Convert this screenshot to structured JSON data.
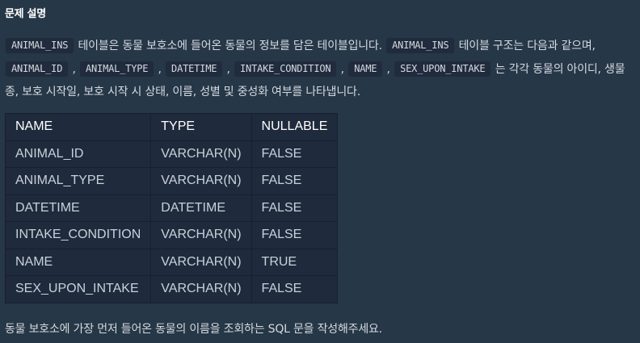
{
  "section_title": "문제 설명",
  "description": {
    "code_table": "ANIMAL_INS",
    "text_1": " 테이블은 동물 보호소에 들어온 동물의 정보를 담은 테이블입니다. ",
    "code_table_2": "ANIMAL_INS",
    "text_2": " 테이블 구조는 다음과 같으며, ",
    "code_col_1": "ANIMAL_ID",
    "sep_1": " , ",
    "code_col_2": "ANIMAL_TYPE",
    "sep_2": " , ",
    "code_col_3": "DATETIME",
    "sep_3": " , ",
    "code_col_4": "INTAKE_CONDITION",
    "sep_4": " , ",
    "code_col_5": "NAME",
    "sep_5": " , ",
    "code_col_6": "SEX_UPON_INTAKE",
    "text_3": " 는 각각 동물의 아이디, 생물 종, 보호 시작일, 보호 시작 시 상태, 이름, 성별 및 중성화 여부를 나타냅니다."
  },
  "schema_table": {
    "headers": [
      "NAME",
      "TYPE",
      "NULLABLE"
    ],
    "rows": [
      [
        "ANIMAL_ID",
        "VARCHAR(N)",
        "FALSE"
      ],
      [
        "ANIMAL_TYPE",
        "VARCHAR(N)",
        "FALSE"
      ],
      [
        "DATETIME",
        "DATETIME",
        "FALSE"
      ],
      [
        "INTAKE_CONDITION",
        "VARCHAR(N)",
        "FALSE"
      ],
      [
        "NAME",
        "VARCHAR(N)",
        "TRUE"
      ],
      [
        "SEX_UPON_INTAKE",
        "VARCHAR(N)",
        "FALSE"
      ]
    ]
  },
  "question": "동물 보호소에 가장 먼저 들어온 동물의 이름을 조회하는 SQL 문을 작성해주세요.",
  "colors": {
    "background": "#263747",
    "code_background": "#202b3d",
    "table_background": "#1f2a3c",
    "table_border": "#172030",
    "text": "#d5dae0",
    "heading": "#ffffff"
  }
}
